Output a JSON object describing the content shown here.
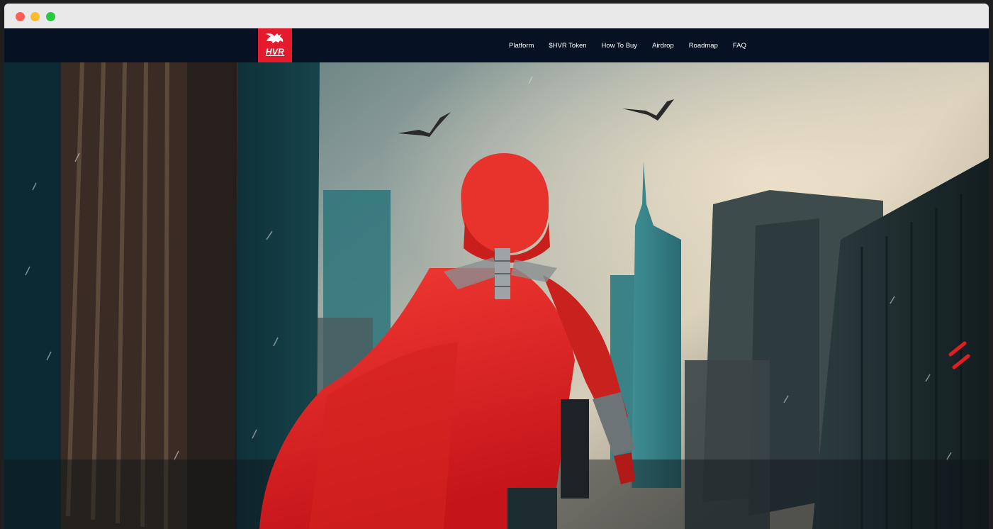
{
  "window": {
    "controls": [
      "close",
      "minimize",
      "maximize"
    ],
    "colors": {
      "close": "#ff5f57",
      "minimize": "#febc2e",
      "maximize": "#28c840"
    }
  },
  "brand": {
    "logo_text": "HVR",
    "logo_icon": "winged-lion-icon",
    "accent": "#e51b2d",
    "nav_bg": "#061224"
  },
  "nav": {
    "items": [
      {
        "label": "Platform"
      },
      {
        "label": "$HVR Token"
      },
      {
        "label": "How To Buy"
      },
      {
        "label": "Airdrop"
      },
      {
        "label": "Roadmap"
      },
      {
        "label": "FAQ"
      }
    ]
  },
  "hero": {
    "image": "hooded-red-caped-hero-city-scene"
  }
}
